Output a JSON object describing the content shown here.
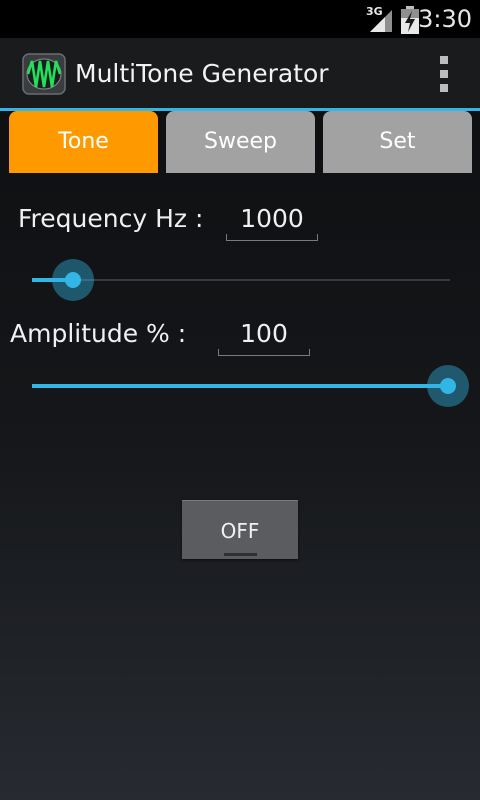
{
  "status_bar": {
    "network": "3G",
    "time": "3:30"
  },
  "action_bar": {
    "title": "MultiTone Generator"
  },
  "tabs": [
    {
      "label": "Tone",
      "active": true
    },
    {
      "label": "Sweep",
      "active": false
    },
    {
      "label": "Set",
      "active": false
    }
  ],
  "frequency": {
    "label": "Frequency Hz :",
    "value": "1000",
    "slider_fraction": 0.05
  },
  "amplitude": {
    "label": "Amplitude % :",
    "value": "100",
    "slider_fraction": 1.0
  },
  "toggle_button": {
    "label": "OFF"
  },
  "colors": {
    "accent": "#33b5e5",
    "active_tab": "#ff9900",
    "inactive_tab": "#a2a2a2"
  }
}
